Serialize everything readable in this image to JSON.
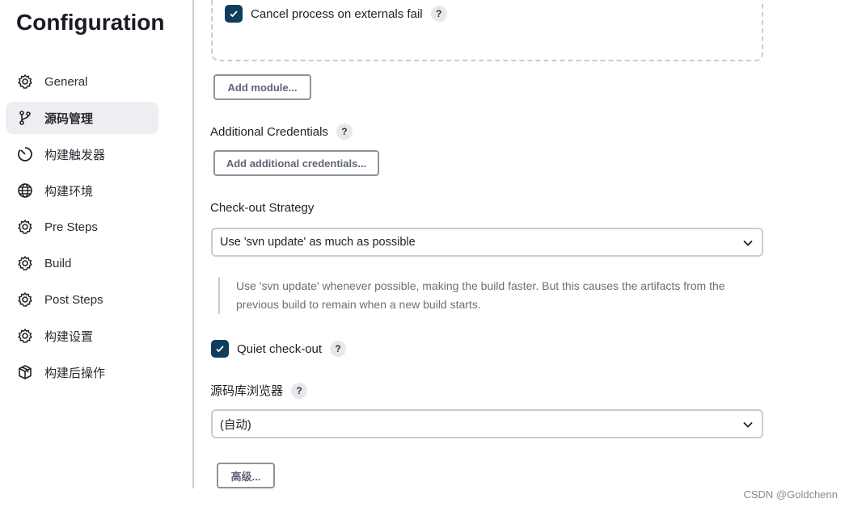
{
  "sidebar": {
    "title": "Configuration",
    "items": [
      {
        "label": "General",
        "icon": "gear-icon"
      },
      {
        "label": "源码管理",
        "icon": "branch-icon",
        "active": true
      },
      {
        "label": "构建触发器",
        "icon": "timer-icon"
      },
      {
        "label": "构建环境",
        "icon": "globe-icon"
      },
      {
        "label": "Pre Steps",
        "icon": "gear-icon"
      },
      {
        "label": "Build",
        "icon": "gear-icon"
      },
      {
        "label": "Post Steps",
        "icon": "gear-icon"
      },
      {
        "label": "构建设置",
        "icon": "gear-icon"
      },
      {
        "label": "构建后操作",
        "icon": "package-icon"
      }
    ]
  },
  "main": {
    "cancel_process_label": "Cancel process on externals fail",
    "cancel_process_checked": true,
    "add_module": "Add module...",
    "additional_credentials_label": "Additional Credentials",
    "add_credentials": "Add additional credentials...",
    "checkout_strategy_label": "Check-out Strategy",
    "checkout_strategy_value": "Use 'svn update' as much as possible",
    "checkout_desc_1": "Use 'svn update' whenever possible, making the build faster. But this causes the artifacts from the",
    "checkout_desc_2": "previous build to remain when a new build starts.",
    "quiet_checkout_label": "Quiet check-out",
    "quiet_checkout_checked": true,
    "repo_browser_label": "源码库浏览器",
    "repo_browser_value": "(自动)",
    "advanced": "高级...",
    "help": "?"
  },
  "watermark": "CSDN @Goldchenn",
  "colors": {
    "checkbox": "#0f3d5c",
    "active_nav": "#eeeef2"
  }
}
